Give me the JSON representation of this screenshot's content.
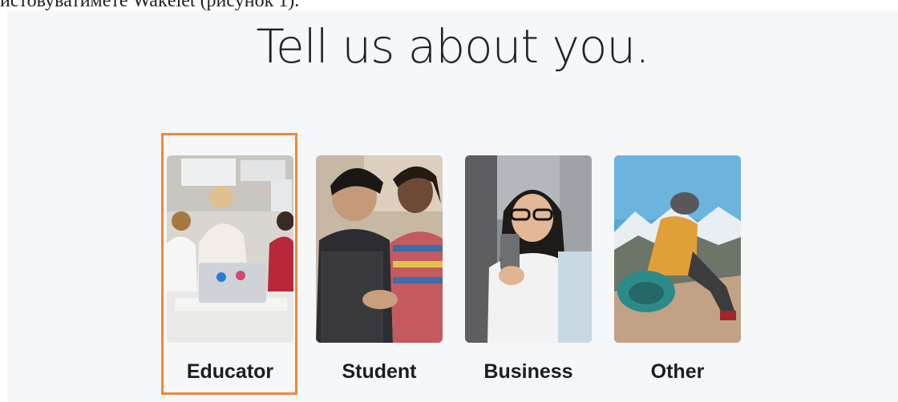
{
  "caption": "истовуватимете Wakelet (рисунок 1).",
  "title": "Tell us about you.",
  "options": [
    {
      "label": "Educator",
      "selected": true,
      "image": "educator-photo"
    },
    {
      "label": "Student",
      "selected": false,
      "image": "student-photo"
    },
    {
      "label": "Business",
      "selected": false,
      "image": "business-photo"
    },
    {
      "label": "Other",
      "selected": false,
      "image": "other-photo"
    }
  ],
  "colors": {
    "selection_border": "#f0883a",
    "background": "#f5f7f9",
    "title": "#1f2329"
  }
}
